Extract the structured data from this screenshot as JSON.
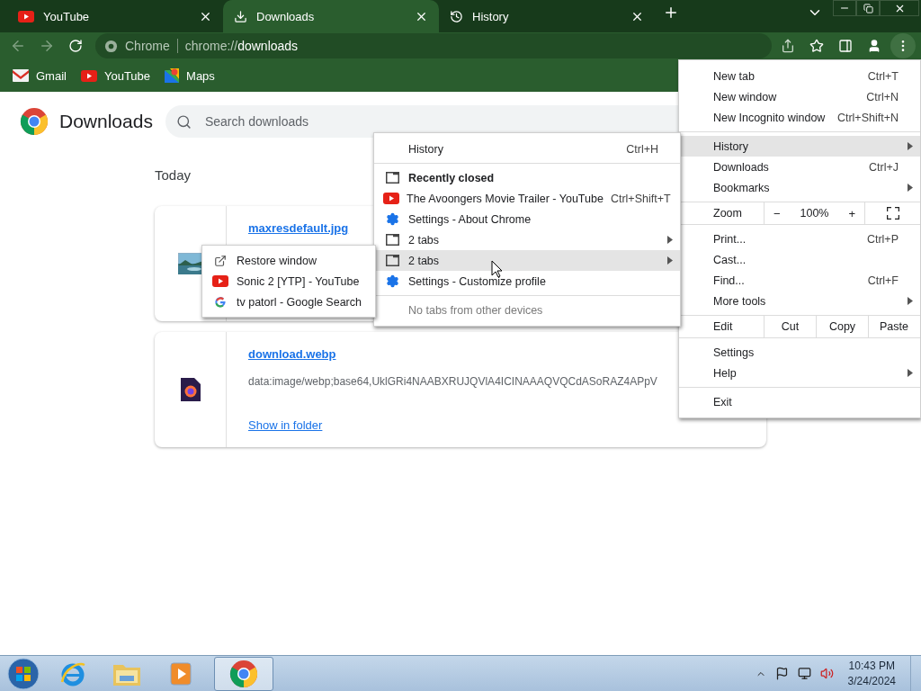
{
  "tabs": [
    {
      "title": "YouTube",
      "kind": "youtube",
      "selected": false
    },
    {
      "title": "Downloads",
      "kind": "download",
      "selected": true
    },
    {
      "title": "History",
      "kind": "history",
      "selected": false
    }
  ],
  "omnibox": {
    "chip": "Chrome",
    "url": "chrome://**downloads**"
  },
  "bookmarks": [
    {
      "label": "Gmail",
      "kind": "gmail"
    },
    {
      "label": "YouTube",
      "kind": "youtube"
    },
    {
      "label": "Maps",
      "kind": "maps"
    }
  ],
  "page": {
    "title": "Downloads",
    "search_placeholder": "Search downloads",
    "section": "Today",
    "downloads": [
      {
        "file": "maxresdefault.jpg"
      },
      {
        "file": "download.webp",
        "kind": "webp",
        "url": "data:image/webp;base64,UklGRi4NAABXRUJQVlA4ICINAAAQVQCdASoRAZ4APpV",
        "action": "Show in folder"
      }
    ]
  },
  "app_menu": [
    {
      "kind": "item",
      "label": "New tab",
      "shortcut": "Ctrl+T",
      "submenu": false,
      "selected": false
    },
    {
      "kind": "item",
      "label": "New window",
      "shortcut": "Ctrl+N",
      "submenu": false,
      "selected": false
    },
    {
      "kind": "item",
      "label": "New Incognito window",
      "shortcut": "Ctrl+Shift+N",
      "submenu": false,
      "selected": false
    },
    {
      "kind": "separator"
    },
    {
      "kind": "item",
      "label": "History",
      "submenu": true,
      "selected": true
    },
    {
      "kind": "item",
      "label": "Downloads",
      "shortcut": "Ctrl+J",
      "submenu": false,
      "selected": false
    },
    {
      "kind": "item",
      "label": "Bookmarks",
      "submenu": true,
      "selected": false
    },
    {
      "kind": "zoom",
      "label": "Zoom",
      "minus": "−",
      "value": "100%",
      "plus": "+"
    },
    {
      "kind": "item",
      "label": "Print...",
      "shortcut": "Ctrl+P",
      "submenu": false,
      "selected": false
    },
    {
      "kind": "item",
      "label": "Cast...",
      "submenu": false,
      "selected": false
    },
    {
      "kind": "item",
      "label": "Find...",
      "shortcut": "Ctrl+F",
      "submenu": false,
      "selected": false
    },
    {
      "kind": "item",
      "label": "More tools",
      "submenu": true,
      "selected": false
    },
    {
      "kind": "edit",
      "label": "Edit",
      "actions": [
        "Cut",
        "Copy",
        "Paste"
      ]
    },
    {
      "kind": "item",
      "label": "Settings",
      "submenu": false,
      "selected": false
    },
    {
      "kind": "item",
      "label": "Help",
      "submenu": true,
      "selected": false
    },
    {
      "kind": "separator"
    },
    {
      "kind": "item",
      "label": "Exit",
      "submenu": false,
      "selected": false
    }
  ],
  "history_menu": [
    {
      "kind": "item",
      "label": "History",
      "shortcut": "Ctrl+H",
      "submenu": false,
      "selected": false
    },
    {
      "kind": "separator"
    },
    {
      "kind": "heading",
      "label": "Recently closed"
    },
    {
      "kind": "youtube",
      "label": "The Avoongers Movie Trailer - YouTube",
      "shortcut": "Ctrl+Shift+T",
      "submenu": false,
      "selected": false
    },
    {
      "kind": "settings",
      "label": "Settings - About Chrome",
      "submenu": false,
      "selected": false
    },
    {
      "kind": "window",
      "label": "2 tabs",
      "submenu": true,
      "selected": false
    },
    {
      "kind": "window",
      "label": "2 tabs",
      "submenu": true,
      "selected": true
    },
    {
      "kind": "settings",
      "label": "Settings - Customize profile",
      "submenu": false,
      "selected": false
    },
    {
      "kind": "separator"
    },
    {
      "kind": "note",
      "label": "No tabs from other devices"
    }
  ],
  "tabs_menu": [
    {
      "kind": "restore",
      "label": "Restore window"
    },
    {
      "kind": "youtube",
      "label": "Sonic 2 [YTP] - YouTube"
    },
    {
      "kind": "google",
      "label": "tv patorl - Google Search"
    }
  ],
  "taskbar": {
    "apps": [
      {
        "kind": "ie",
        "selected": false
      },
      {
        "kind": "explorer",
        "selected": false
      },
      {
        "kind": "media",
        "selected": false
      },
      {
        "kind": "chrome",
        "selected": true
      }
    ],
    "time": "10:43 PM",
    "date": "3/24/2024"
  }
}
